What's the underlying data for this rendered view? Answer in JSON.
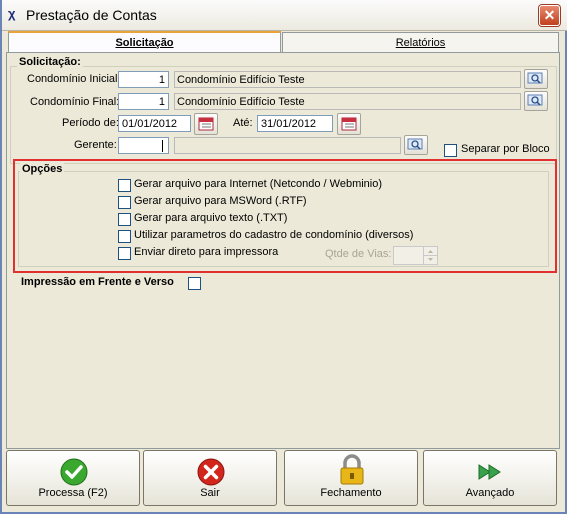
{
  "window": {
    "title": "Prestação de Contas",
    "close_glyph": "✕"
  },
  "tabs": [
    {
      "label": "Solicitação"
    },
    {
      "label": "Relatórios"
    }
  ],
  "solicitacao": {
    "section_label": "Solicitação:",
    "condominio_inicial": {
      "label": "Condomínio Inicial:",
      "code": "1",
      "name": "Condomínio Edifício Teste"
    },
    "condominio_final": {
      "label": "Condomínio Final:",
      "code": "1",
      "name": "Condomínio Edifício Teste"
    },
    "periodo": {
      "label": "Período de:",
      "from": "01/01/2012",
      "until_label": "Até:",
      "to": "31/01/2012"
    },
    "gerente": {
      "label": "Gerente:",
      "code": "",
      "name": ""
    },
    "separar_por_bloco": {
      "label": "Separar por Bloco",
      "checked": false
    }
  },
  "opcoes": {
    "section_label": "Opções",
    "options": [
      {
        "label": "Gerar arquivo para Internet (Netcondo / Webminio)",
        "checked": false
      },
      {
        "label": "Gerar arquivo para MSWord (.RTF)",
        "checked": false
      },
      {
        "label": "Gerar para arquivo texto (.TXT)",
        "checked": false
      },
      {
        "label": "Utilizar parametros do cadastro de condomínio (diversos)",
        "checked": false
      },
      {
        "label": "Enviar direto para impressora",
        "checked": false
      }
    ],
    "qtde_vias": {
      "label": "Qtde de Vias:",
      "value": ""
    }
  },
  "impressao_frente_verso": {
    "label": "Impressão em Frente e Verso",
    "checked": false
  },
  "buttons": {
    "processa": "Processa (F2)",
    "sair": "Sair",
    "fechamento": "Fechamento",
    "avancado": "Avançado"
  },
  "colors": {
    "highlight_border": "#e03030",
    "active_tab_accent": "#e8a33d",
    "ok_green": "#3aa82f",
    "exit_red": "#d2261c",
    "lock_yellow": "#e9b618"
  }
}
